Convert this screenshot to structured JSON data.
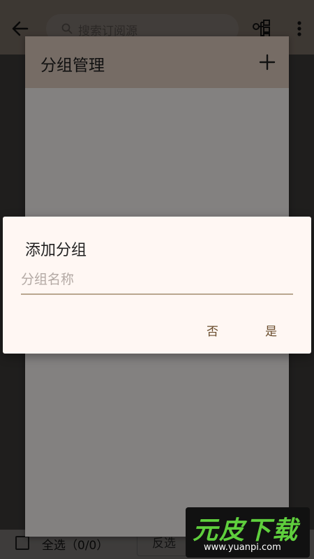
{
  "toolbar": {
    "search_placeholder": "搜索订阅源",
    "back_icon": "arrow-left-icon",
    "group_icon": "group-tree-icon",
    "more_icon": "more-vertical-icon"
  },
  "panel": {
    "title": "分组管理",
    "add_icon": "plus-icon"
  },
  "dialog": {
    "title": "添加分组",
    "input_placeholder": "分组名称",
    "input_value": "",
    "cancel_label": "否",
    "confirm_label": "是"
  },
  "bottom_bar": {
    "select_all_label": "全选（0/0）",
    "invert_label": "反选"
  },
  "watermark": {
    "main": "元皮下载",
    "sub": "www.yuanpi.com"
  },
  "colors": {
    "accent": "#6a4c2c",
    "header_bg": "#e3d0c2",
    "dialog_bg": "#fff7f3",
    "underline": "#b9a68f"
  }
}
